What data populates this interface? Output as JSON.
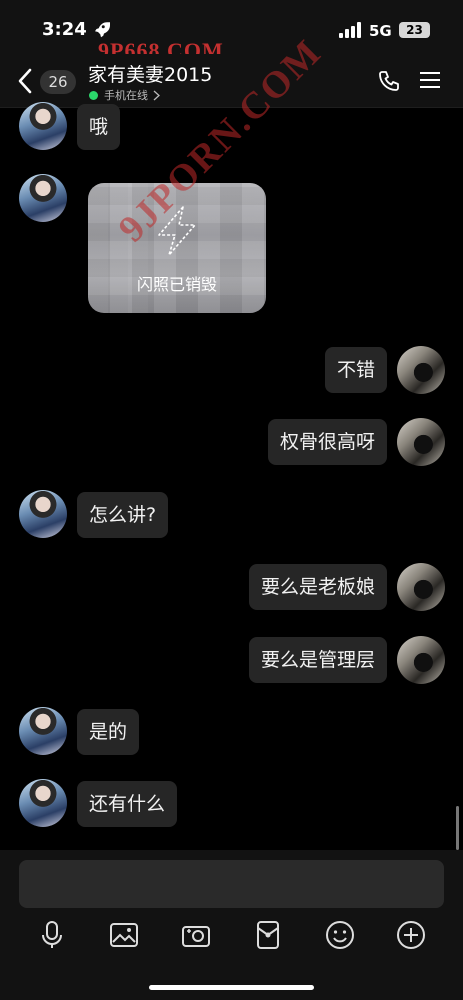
{
  "status_bar": {
    "time": "3:24",
    "network": "5G",
    "battery": "23"
  },
  "watermarks": {
    "top": "9P668.COM",
    "diagonal": "9JPORN.COM"
  },
  "header": {
    "unread_count": "26",
    "title": "家有美妻2015",
    "presence": "手机在线"
  },
  "messages": [
    {
      "side": "left",
      "text": "哦"
    },
    {
      "side": "left",
      "type": "flash_image",
      "text": "闪照已销毁"
    },
    {
      "side": "right",
      "text": "不错"
    },
    {
      "side": "right",
      "text": "权骨很高呀"
    },
    {
      "side": "left",
      "text": "怎么讲?"
    },
    {
      "side": "right",
      "text": "要么是老板娘"
    },
    {
      "side": "right",
      "text": "要么是管理层"
    },
    {
      "side": "left",
      "text": "是的"
    },
    {
      "side": "left",
      "text": "还有什么"
    }
  ],
  "input": {
    "placeholder": ""
  },
  "toolbar": [
    "microphone-icon",
    "image-icon",
    "camera-icon",
    "red-packet-icon",
    "emoji-icon",
    "plus-icon"
  ],
  "colors": {
    "background": "#000000",
    "bubble": "#262626",
    "online": "#2bd66b",
    "watermark": "#c43030"
  }
}
